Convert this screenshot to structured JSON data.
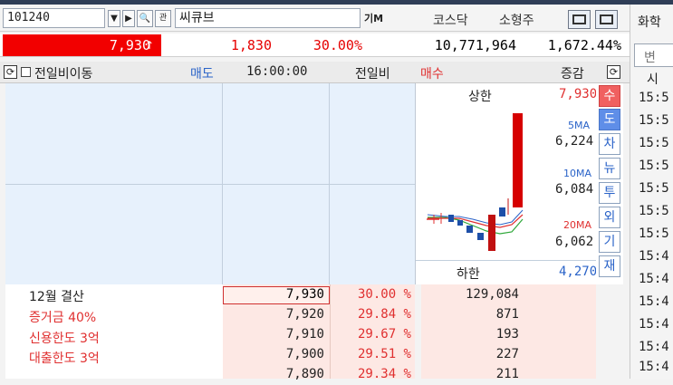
{
  "stock": {
    "code": "101240",
    "name": "씨큐브",
    "flag": "기M",
    "market": "코스닥",
    "cap_class": "소형주"
  },
  "quote": {
    "price": "7,930",
    "rise_arrow": "↑",
    "change": "1,830",
    "change_pct": "30.00%",
    "volume": "10,771,964",
    "volume_ratio": "1,672.44%"
  },
  "header": {
    "checkbox_label": "전일비이동",
    "ask_label": "매도",
    "time": "16:00:00",
    "diff_label": "전일비",
    "bid_label": "매수",
    "change_label": "증감"
  },
  "chart_panel": {
    "upper_limit_label": "상한",
    "upper_limit": "7,930",
    "lower_limit_label": "하한",
    "lower_limit": "4,270",
    "ma5_label": "5MA",
    "ma5": "6,224",
    "ma10_label": "10MA",
    "ma10": "6,084",
    "ma20_label": "20MA",
    "ma20": "6,062"
  },
  "side_tabs": [
    "수",
    "도",
    "차",
    "뉴",
    "투",
    "외",
    "기",
    "재"
  ],
  "info_lines": [
    "12월 결산",
    "증거금 40%",
    "신용한도 3억",
    "대출한도 3억"
  ],
  "bids": [
    {
      "price": "7,930",
      "pct": "30.00 %",
      "qty": "129,084"
    },
    {
      "price": "7,920",
      "pct": "29.84 %",
      "qty": "871"
    },
    {
      "price": "7,910",
      "pct": "29.67 %",
      "qty": "193"
    },
    {
      "price": "7,900",
      "pct": "29.51 %",
      "qty": "227"
    },
    {
      "price": "7,890",
      "pct": "29.34 %",
      "qty": "211"
    }
  ],
  "right_strip": {
    "top_label": "화학",
    "tab_label": "변",
    "header": "시",
    "times": [
      "15:5",
      "15:5",
      "15:5",
      "15:5",
      "15:5",
      "15:5",
      "15:5",
      "15:4",
      "15:4",
      "15:4",
      "15:4",
      "15:4",
      "15:4"
    ]
  },
  "colors": {
    "up": "#f20000",
    "ask_bg": "#e7f1fc",
    "bid_bg": "#fde8e4"
  }
}
